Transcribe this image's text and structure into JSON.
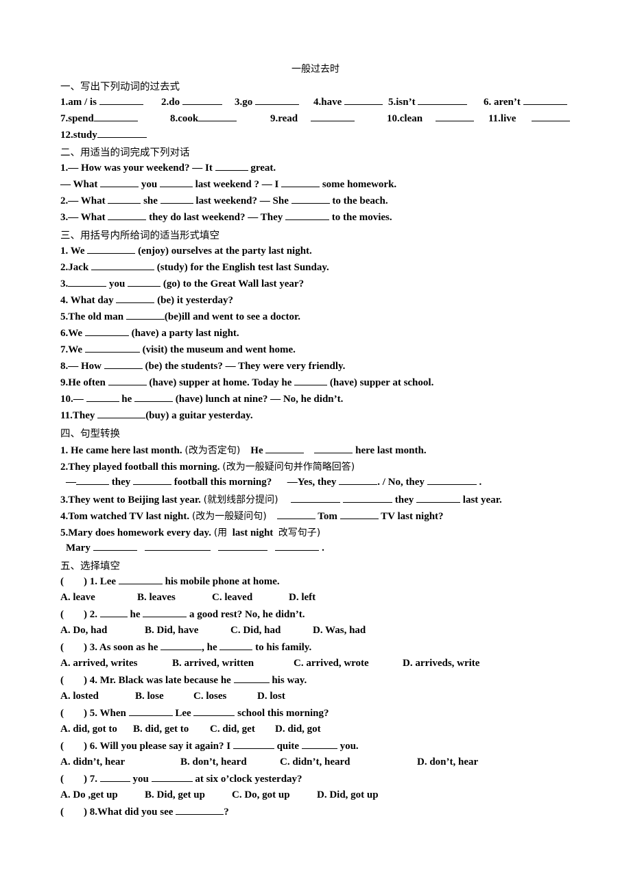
{
  "title": "一般过去时",
  "sections": {
    "s1": {
      "heading": "一、写出下列动词的过去式",
      "items": [
        "1.am / is",
        "2.do",
        "3.go",
        "4.have",
        "5.isn’t",
        "6. aren’t",
        "7.spend",
        "8.cook",
        "9.read",
        "10.clean",
        "11.live",
        "12.study"
      ]
    },
    "s2": {
      "heading": "二、用适当的词完成下列对话",
      "lines": [
        [
          "1.— How was your weekend? — It",
          "great."
        ],
        [
          "— What",
          "you",
          "last weekend ? — I",
          "some homework."
        ],
        [
          "2.— What",
          "she",
          "last weekend? — She",
          "to the beach."
        ],
        [
          "3.— What",
          "they do last weekend? — They",
          "to the movies."
        ]
      ]
    },
    "s3": {
      "heading": "三、用括号内所给词的适当形式填空",
      "lines": [
        [
          "1. We",
          "(enjoy) ourselves at the party last night."
        ],
        [
          "2.Jack",
          "(study) for the English test last Sunday."
        ],
        [
          "3.",
          "you",
          "(go) to the Great Wall last year?"
        ],
        [
          "4. What day",
          "(be) it yesterday?"
        ],
        [
          "5.The old man",
          "(be)ill and went to see a doctor."
        ],
        [
          "6.We",
          "(have) a party last night."
        ],
        [
          "7.We",
          "(visit) the museum and went home."
        ],
        [
          "8.— How",
          "(be) the students? — They were very friendly."
        ],
        [
          "9.He often",
          "(have) supper at home. Today he",
          "(have) supper at school."
        ],
        [
          "10.—",
          "he",
          "(have) lunch at nine? — No, he didn’t."
        ],
        [
          "11.They",
          "(buy) a guitar yesterday."
        ]
      ]
    },
    "s4": {
      "heading": "四、句型转换",
      "q1": {
        "a": "1. He came here last month.",
        "cn": "(改为否定句)",
        "b": "He",
        "c": "here last month."
      },
      "q2": {
        "a": "2.They played football this morning.",
        "cn": "(改为一般疑问句并作简略回答)"
      },
      "q2b": {
        "a": "—",
        "b": "they",
        "c": "football this morning?",
        "d": "—Yes, they",
        "e": ". / No, they",
        "f": "."
      },
      "q3": {
        "a": "3.They went to Beijing last year.",
        "cn": "(就划线部分提问)",
        "b": "they",
        "c": "last year."
      },
      "q4": {
        "a": "4.Tom watched TV last night.",
        "cn": "(改为一般疑问句)",
        "b": "Tom",
        "c": "TV last night?"
      },
      "q5": {
        "a": "5.Mary does homework every day.",
        "cn1": "(用",
        "mid": "last night",
        "cn2": "改写句子)"
      },
      "q5b": {
        "a": "Mary",
        "end": "."
      }
    },
    "s5": {
      "heading": "五、选择填空",
      "questions": [
        {
          "q": ") 1. Lee",
          "q2": "his mobile phone at home.",
          "options": [
            "A. leave",
            "B. leaves",
            "C. leaved",
            "D. left"
          ]
        },
        {
          "q": ") 2.",
          "q_mid": "he",
          "q2": "a good rest? No, he didn’t.",
          "options": [
            "A. Do, had",
            "B. Did, have",
            "C. Did, had",
            "D. Was, had"
          ]
        },
        {
          "q": ") 3. As soon as he",
          "q_mid": ", he",
          "q2": "to his family.",
          "options": [
            "A. arrived, writes",
            "B. arrived, written",
            "C. arrived, wrote",
            "D. arriveds, write"
          ]
        },
        {
          "q": ") 4. Mr. Black was late because he",
          "q2": "his way.",
          "options": [
            "A. losted",
            "B. lose",
            "C. loses",
            "D. lost"
          ]
        },
        {
          "q": ") 5. When",
          "q_mid": "Lee",
          "q2": "school this morning?",
          "options": [
            "A. did, got to",
            "B. did, get to",
            "C. did, get",
            "D. did, got"
          ]
        },
        {
          "q": ") 6. Will you please say it again? I",
          "q_mid": "quite",
          "q2": "you.",
          "options": [
            "A. didn’t, hear",
            "B. don’t, heard",
            "C. didn’t, heard",
            "D. don’t, hear"
          ]
        },
        {
          "q": ") 7.",
          "q_mid": "you",
          "q2": "at six o’clock yesterday?",
          "options": [
            "A. Do ,get up",
            "B. Did, get up",
            "C. Do, got up",
            "D. Did, got up"
          ]
        },
        {
          "q": ") 8.What did you see",
          "q2": "?"
        }
      ],
      "paren_open": "("
    }
  }
}
